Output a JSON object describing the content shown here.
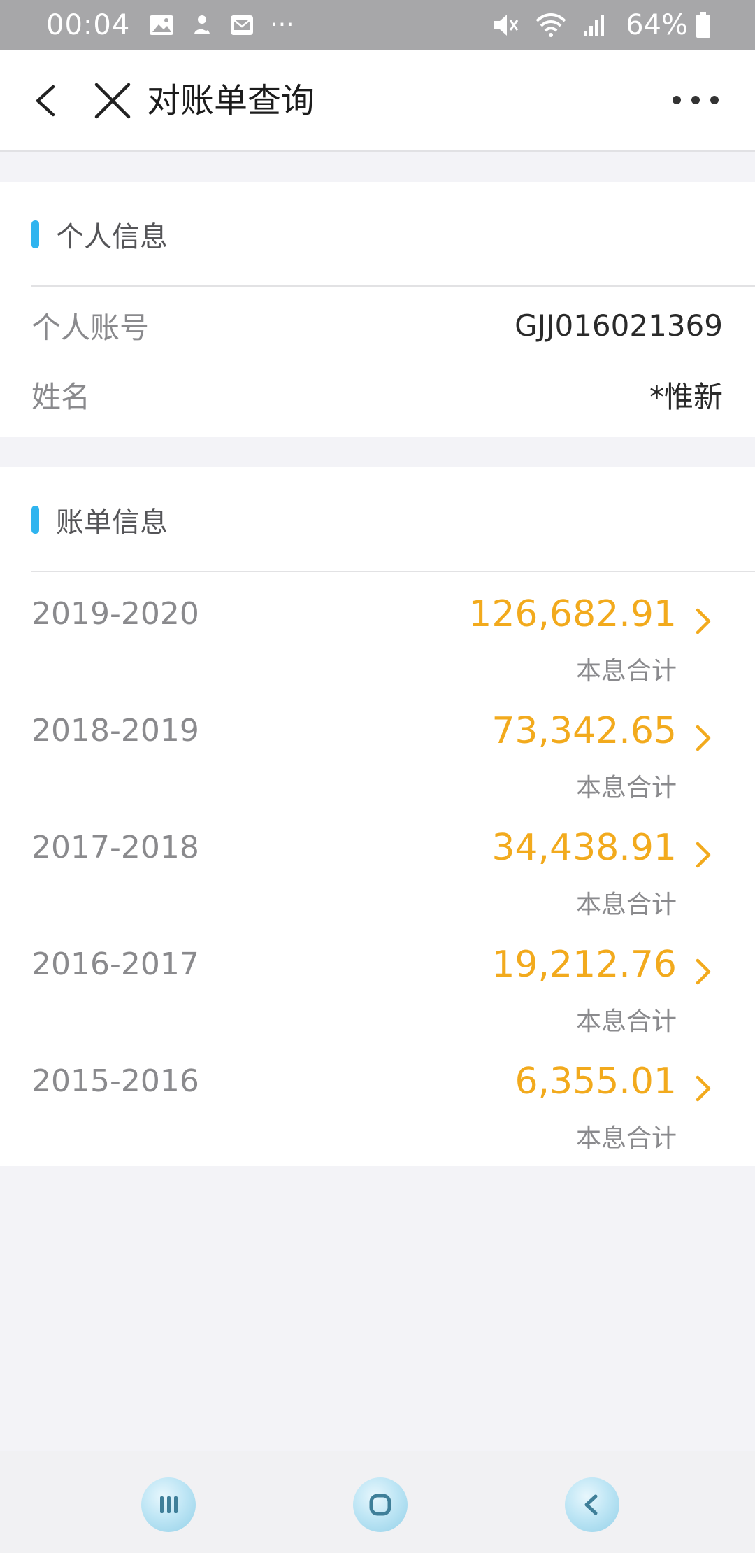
{
  "status_bar": {
    "time": "00:04",
    "overflow": "···",
    "battery": "64%"
  },
  "header": {
    "title": "对账单查询"
  },
  "personal_info": {
    "section_title": "个人信息",
    "rows": [
      {
        "label": "个人账号",
        "value": "GJJ016021369"
      },
      {
        "label": "姓名",
        "value": "*惟新"
      }
    ]
  },
  "bill_info": {
    "section_title": "账单信息",
    "rows": [
      {
        "year": "2019-2020",
        "amount": "126,682.91",
        "sub": "本息合计"
      },
      {
        "year": "2018-2019",
        "amount": "73,342.65",
        "sub": "本息合计"
      },
      {
        "year": "2017-2018",
        "amount": "34,438.91",
        "sub": "本息合计"
      },
      {
        "year": "2016-2017",
        "amount": "19,212.76",
        "sub": "本息合计"
      },
      {
        "year": "2015-2016",
        "amount": "6,355.01",
        "sub": "本息合计"
      }
    ]
  },
  "colors": {
    "accent": "#2fb4ef",
    "amount": "#f2aa1d",
    "status_bar": "#a7a7a9",
    "background": "#f3f3f7"
  },
  "icons": {
    "status_left": [
      "image-icon",
      "app-notification-icon",
      "mail-icon"
    ],
    "status_right": [
      "mute-icon",
      "wifi-icon",
      "signal-icon",
      "battery-icon"
    ],
    "nav": [
      "recents-icon",
      "home-icon",
      "back-icon"
    ]
  }
}
